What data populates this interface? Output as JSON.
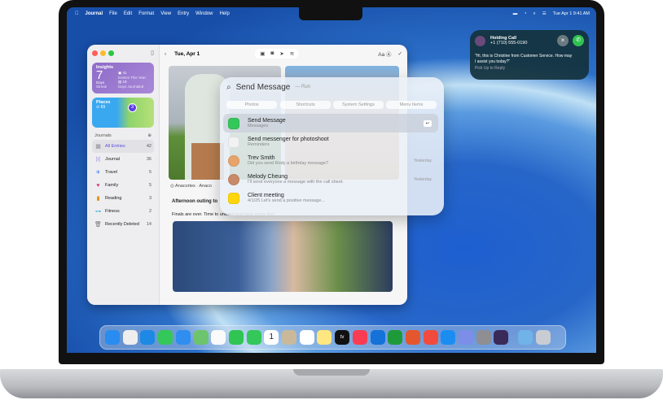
{
  "menubar": {
    "app": "Journal",
    "items": [
      "File",
      "Edit",
      "Format",
      "View",
      "Entry",
      "Window",
      "Help"
    ],
    "datetime": "Tue Apr 1  9:41 AM"
  },
  "notification": {
    "title": "Holding Call",
    "number": "+1 (710) 555-0190",
    "message": "\"Hi, this is Christine from Customer Service. How may I assist you today?\"",
    "action": "Pick Up to Reply",
    "decline_color": "#6b7a80",
    "accept_color": "#30c250"
  },
  "journal": {
    "insights": {
      "label": "Insights",
      "streak_value": "7",
      "streak_unit": "Days",
      "streak_label": "Streak",
      "entries": "41",
      "entries_label": "Entries This Year",
      "days": "19",
      "days_label": "Days Journaled"
    },
    "places": {
      "label": "Places",
      "count": "69",
      "pin": "3"
    },
    "journals_heading": "Journals",
    "items": [
      {
        "label": "All Entries",
        "count": "42",
        "icon": "grid-icon",
        "color": "#8e8e93"
      },
      {
        "label": "Journal",
        "count": "36",
        "icon": "butterfly-icon",
        "color": "#6e5ce6"
      },
      {
        "label": "Travel",
        "count": "5",
        "icon": "airplane-icon",
        "color": "#3b82f6"
      },
      {
        "label": "Family",
        "count": "5",
        "icon": "heart-icon",
        "color": "#d63a7d"
      },
      {
        "label": "Reading",
        "count": "3",
        "icon": "book-icon",
        "color": "#e08a00"
      },
      {
        "label": "Fitness",
        "count": "2",
        "icon": "dumbbell-icon",
        "color": "#16a9c9"
      },
      {
        "label": "Recently Deleted",
        "count": "14",
        "icon": "trash-icon",
        "color": "#777"
      }
    ],
    "date": "Tue, Apr 1",
    "location": "Anacortes · Anaco",
    "entry_title": "Afternoon outing to",
    "entry_body": "Finals are over. Time to unwind and have some fun!"
  },
  "spotlight": {
    "query": "Send Message",
    "hint": "— Run",
    "chips": [
      "Photos",
      "Shortcuts",
      "System Settings",
      "Menu Items"
    ],
    "results": [
      {
        "title": "Send Message",
        "subtitle": "Messages",
        "time": "",
        "color": "#34c759"
      },
      {
        "title": "Send messenger for photoshoot",
        "subtitle": "Reminders",
        "time": "",
        "color": "#f2f2f2"
      },
      {
        "title": "Trev Smith",
        "subtitle": "Did you send Rody a birthday message?",
        "time": "Yesterday",
        "color": "#e8a36a"
      },
      {
        "title": "Melody Cheung",
        "subtitle": "I'll send everyone a message with the call sheet.",
        "time": "Yesterday",
        "color": "#c98a6a"
      },
      {
        "title": "Client meeting",
        "subtitle": "4/1/25 Let's send a positive message...",
        "time": "",
        "color": "#ffd60a"
      }
    ]
  },
  "dock": {
    "apps": [
      {
        "name": "Finder",
        "color": "#2a8cf0"
      },
      {
        "name": "Launchpad",
        "color": "#eee"
      },
      {
        "name": "Safari",
        "color": "#1e88e5"
      },
      {
        "name": "Messages",
        "color": "#34c759"
      },
      {
        "name": "Mail",
        "color": "#2f8ef0"
      },
      {
        "name": "Maps",
        "color": "#6cc56c"
      },
      {
        "name": "Photos",
        "color": "#fafafa"
      },
      {
        "name": "FaceTime",
        "color": "#30c453"
      },
      {
        "name": "Phone",
        "color": "#34c759"
      },
      {
        "name": "Calendar",
        "color": "#fff"
      },
      {
        "name": "Contacts",
        "color": "#c9b99a"
      },
      {
        "name": "Reminders",
        "color": "#fff"
      },
      {
        "name": "Notes",
        "color": "#ffe680"
      },
      {
        "name": "TV",
        "color": "#111"
      },
      {
        "name": "Music",
        "color": "#fa3c52"
      },
      {
        "name": "Keynote",
        "color": "#1572d8"
      },
      {
        "name": "Numbers",
        "color": "#1f9a3a"
      },
      {
        "name": "Pages",
        "color": "#e4572e"
      },
      {
        "name": "Rocket",
        "color": "#f24b3d"
      },
      {
        "name": "App Store",
        "color": "#1b8df2"
      },
      {
        "name": "iPhone Mirroring",
        "color": "#7c8ee8"
      },
      {
        "name": "System Settings",
        "color": "#8e8e93"
      },
      {
        "name": "Journal",
        "color": "#3a2a5a"
      },
      {
        "name": "Downloads",
        "color": "#6fb3e8"
      },
      {
        "name": "Trash",
        "color": "#c9ccd2"
      }
    ],
    "calendar_day": "1",
    "tv_label": "tv"
  }
}
